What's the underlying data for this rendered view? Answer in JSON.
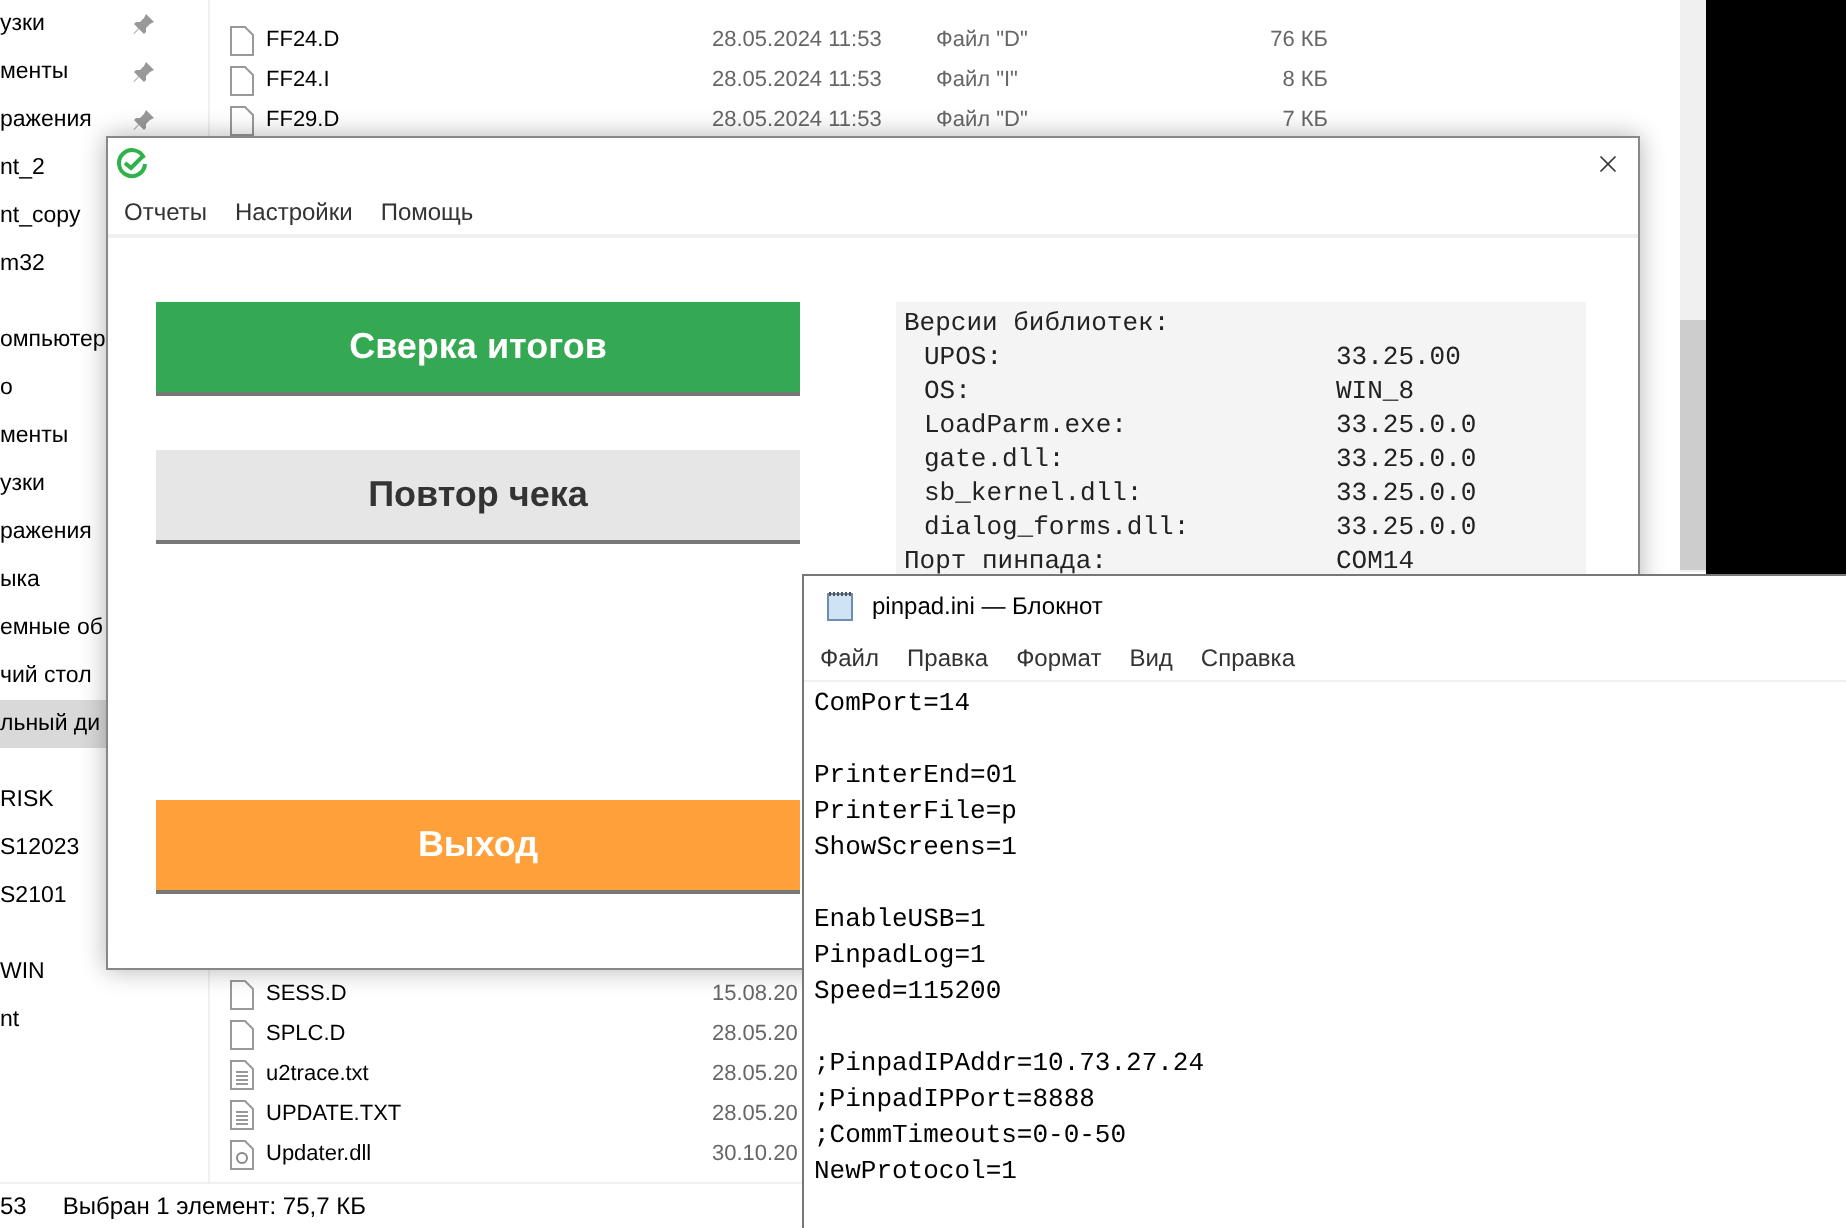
{
  "explorer": {
    "sidebar": {
      "groups": [
        {
          "items": [
            {
              "label": "узки",
              "pinned": true,
              "selected": false
            },
            {
              "label": "менты",
              "pinned": true,
              "selected": false
            },
            {
              "label": "ражения",
              "pinned": true,
              "selected": false
            },
            {
              "label": "nt_2",
              "selected": false
            },
            {
              "label": "nt_copy",
              "selected": false
            },
            {
              "label": "m32",
              "selected": false
            }
          ]
        },
        {
          "items": [
            {
              "label": "омпьютер",
              "selected": false
            },
            {
              "label": "о",
              "selected": false
            },
            {
              "label": "менты",
              "selected": false
            },
            {
              "label": "узки",
              "selected": false
            },
            {
              "label": "ражения",
              "selected": false
            },
            {
              "label": "ыка",
              "selected": false
            },
            {
              "label": "емные об",
              "selected": false
            },
            {
              "label": "чий стол",
              "selected": false
            },
            {
              "label": "льный ди",
              "selected": true
            }
          ]
        },
        {
          "items": [
            {
              "label": "RISK",
              "selected": false
            },
            {
              "label": "S12023",
              "selected": false
            },
            {
              "label": "S2101",
              "selected": false
            }
          ]
        },
        {
          "items": [
            {
              "label": "WIN",
              "selected": false
            },
            {
              "label": "nt",
              "selected": false
            }
          ]
        }
      ]
    },
    "files_top": [
      {
        "kind": "blank",
        "name": "FF24.D",
        "date": "28.05.2024 11:53",
        "type": "Файл \"D\"",
        "size": "76 КБ"
      },
      {
        "kind": "blank",
        "name": "FF24.I",
        "date": "28.05.2024 11:53",
        "type": "Файл \"I\"",
        "size": "8 КБ"
      },
      {
        "kind": "blank",
        "name": "FF29.D",
        "date": "28.05.2024 11:53",
        "type": "Файл \"D\"",
        "size": "7 КБ"
      }
    ],
    "files_bottom": [
      {
        "kind": "blank",
        "name": "SESS.D",
        "date": "15.08.20"
      },
      {
        "kind": "blank",
        "name": "SPLC.D",
        "date": "28.05.20"
      },
      {
        "kind": "text",
        "name": "u2trace.txt",
        "date": "28.05.20"
      },
      {
        "kind": "text",
        "name": "UPDATE.TXT",
        "date": "28.05.20"
      },
      {
        "kind": "dll",
        "name": "Updater.dll",
        "date": "30.10.20"
      }
    ],
    "status_bar": {
      "count": "53",
      "selection": "Выбран 1 элемент: 75,7 КБ"
    }
  },
  "dialog": {
    "menu": [
      "Отчеты",
      "Настройки",
      "Помощь"
    ],
    "buttons": [
      {
        "label": "Сверка итогов",
        "kind": "green"
      },
      {
        "label": "Повтор чека",
        "kind": "gray"
      },
      {
        "label": "Выход",
        "kind": "orange"
      }
    ],
    "info": [
      {
        "label": "Версии библиотек:",
        "children": [
          {
            "label": "UPOS:",
            "value": "33.25.00"
          },
          {
            "label": "OS:",
            "value": "WIN_8"
          },
          {
            "label": "LoadParm.exe:",
            "value": "33.25.0.0"
          },
          {
            "label": "gate.dll:",
            "value": "33.25.0.0"
          },
          {
            "label": "sb_kernel.dll:",
            "value": "33.25.0.0"
          },
          {
            "label": "dialog_forms.dll:",
            "value": "33.25.0.0"
          }
        ]
      },
      {
        "label": "Порт пинпада:",
        "value": "COM14"
      }
    ]
  },
  "notepad": {
    "title": "pinpad.ini — Блокнот",
    "menu": [
      "Файл",
      "Правка",
      "Формат",
      "Вид",
      "Справка"
    ],
    "text": "ComPort=14\n\nPrinterEnd=01\nPrinterFile=p\nShowScreens=1\n\nEnableUSB=1\nPinpadLog=1\nSpeed=115200\n\n;PinpadIPAddr=10.73.27.24\n;PinpadIPPort=8888\n;CommTimeouts=0-0-50\nNewProtocol=1"
  }
}
